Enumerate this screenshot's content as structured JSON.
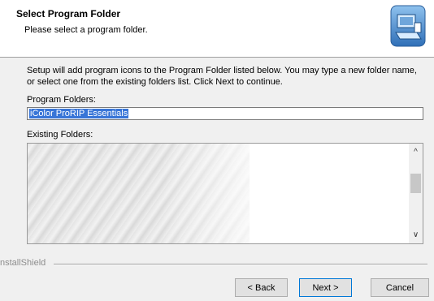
{
  "header": {
    "title": "Select Program Folder",
    "subtitle": "Please select a program folder."
  },
  "body": {
    "description": "Setup will add program icons to the Program Folder listed below.  You may type a new folder name, or select one from the existing folders list.  Click Next to continue."
  },
  "program_folder": {
    "label": "Program Folders:",
    "value": "iColor ProRIP Essentials"
  },
  "existing_folders": {
    "label": "Existing Folders:"
  },
  "footer": {
    "brand": "nstallShield"
  },
  "buttons": {
    "back": "< Back",
    "next": "Next >",
    "cancel": "Cancel"
  }
}
